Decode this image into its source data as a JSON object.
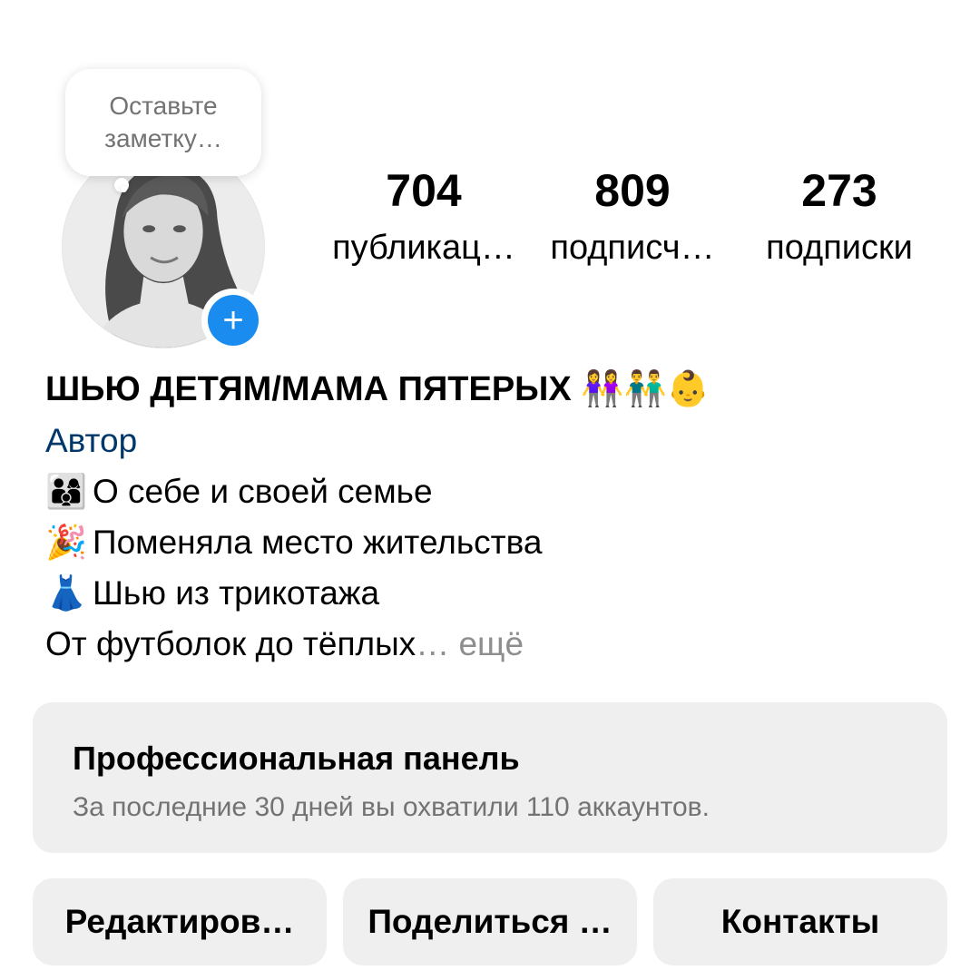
{
  "profile": {
    "note_placeholder": "Оставьте заметку…",
    "add_story_symbol": "+"
  },
  "stats": [
    {
      "value": "704",
      "label": "публикац…"
    },
    {
      "value": "809",
      "label": "подписч…"
    },
    {
      "value": "273",
      "label": "подписки"
    }
  ],
  "bio": {
    "name": "ШЬЮ ДЕТЯМ/МАМА ПЯТЕРЫХ 👭👬👶",
    "category": "Автор",
    "lines": [
      {
        "emoji": "👨‍👩‍👦",
        "text": "О себе  и своей семье"
      },
      {
        "emoji": "🎉",
        "text": "Поменяла место жительства"
      },
      {
        "emoji": "👗",
        "text": "Шью из трикотажа"
      }
    ],
    "truncated_text": "От футболок до тёплых",
    "more_label": "… ещё"
  },
  "pro_panel": {
    "title": "Профессиональная панель",
    "subtitle": "За последние 30 дней вы охватили 110 аккаунтов."
  },
  "buttons": {
    "edit": "Редактиров…",
    "share": "Поделиться …",
    "contacts": "Контакты"
  }
}
